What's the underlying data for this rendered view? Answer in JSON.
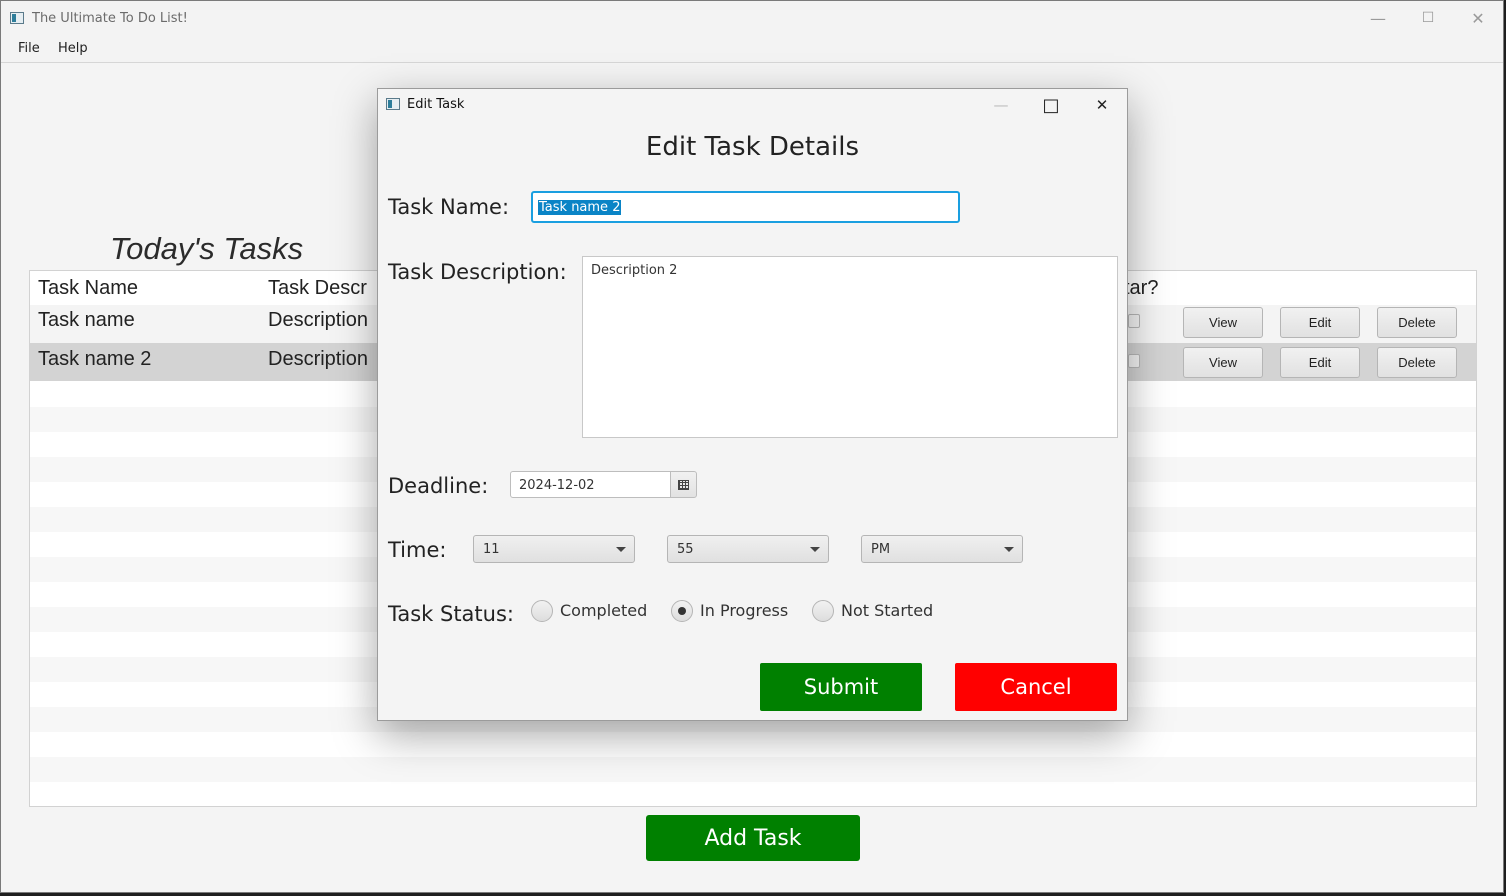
{
  "window": {
    "title": "The Ultimate To Do List!",
    "minimize_glyph": "—",
    "maximize_glyph": "☐",
    "close_glyph": "✕"
  },
  "menu": {
    "items": [
      "File",
      "Help"
    ]
  },
  "page": {
    "heading": "Today's Tasks"
  },
  "table": {
    "columns": [
      "Task Name",
      "Task Descr",
      "tar?"
    ],
    "rows": [
      {
        "name": "Task name",
        "description": "Description"
      },
      {
        "name": "Task name 2",
        "description": "Description"
      }
    ],
    "row_actions": [
      "View",
      "Edit",
      "Delete"
    ],
    "selected_row": 1
  },
  "add_task": {
    "label": "Add Task",
    "color": "#008000"
  },
  "dialog": {
    "title": "Edit Task",
    "heading": "Edit Task Details",
    "minimize_glyph": "—",
    "maximize_glyph": "□",
    "close_glyph": "✕",
    "task_name": {
      "label": "Task Name:",
      "value": "Task name 2"
    },
    "task_description": {
      "label": "Task Description:",
      "value": "Description 2"
    },
    "deadline": {
      "label": "Deadline:",
      "value": "2024-12-02",
      "icon": "calendar-icon"
    },
    "time": {
      "label": "Time:",
      "hour": "11",
      "minute": "55",
      "ampm": "PM"
    },
    "status": {
      "label": "Task Status:",
      "options": [
        "Completed",
        "In Progress",
        "Not Started"
      ],
      "selected": "In Progress"
    },
    "submit": {
      "label": "Submit",
      "color": "#008000"
    },
    "cancel": {
      "label": "Cancel",
      "color": "#ff0000"
    }
  }
}
